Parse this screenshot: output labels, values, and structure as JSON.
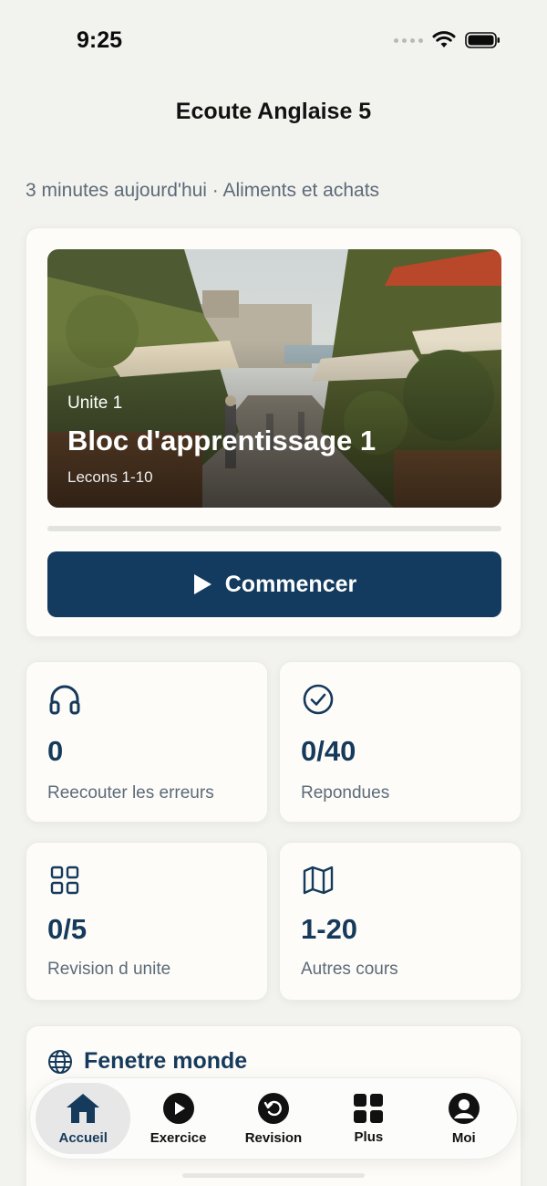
{
  "status": {
    "time": "9:25"
  },
  "header": {
    "title": "Ecoute Anglaise 5"
  },
  "summary": {
    "text": "3 minutes aujourd'hui · Aliments et achats"
  },
  "hero": {
    "unit": "Unite 1",
    "title": "Bloc d'apprentissage 1",
    "lessons": "Lecons 1-10",
    "progress": 0,
    "start_label": "Commencer"
  },
  "stats": [
    {
      "icon": "headphones-icon",
      "value": "0",
      "label": "Reecouter les erreurs"
    },
    {
      "icon": "check-circle-icon",
      "value": "0/40",
      "label": "Repondues"
    },
    {
      "icon": "grid-icon",
      "value": "0/5",
      "label": "Revision d unite"
    },
    {
      "icon": "map-icon",
      "value": "1-20",
      "label": "Autres cours"
    }
  ],
  "world": {
    "title": "Fenetre monde"
  },
  "tabs": [
    {
      "label": "Accueil",
      "icon": "home-icon",
      "active": true
    },
    {
      "label": "Exercice",
      "icon": "play-circle-icon",
      "active": false
    },
    {
      "label": "Revision",
      "icon": "refresh-circle-icon",
      "active": false
    },
    {
      "label": "Plus",
      "icon": "grid-icon",
      "active": false
    },
    {
      "label": "Moi",
      "icon": "profile-icon",
      "active": false
    }
  ],
  "colors": {
    "accent": "#133b5f",
    "background": "#f2f2ee",
    "muted": "#5d6b78"
  }
}
